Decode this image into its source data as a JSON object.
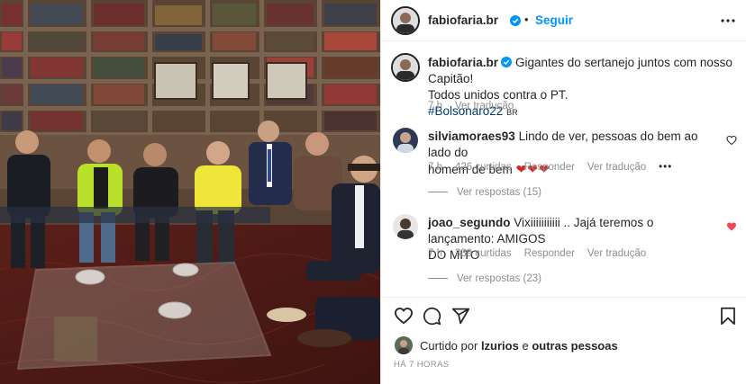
{
  "post": {
    "username": "fabiofaria.br",
    "follow_label": "Seguir",
    "caption_text": "Gigantes do sertanejo juntos com nosso Capitão! Todos unidos contra o PT.",
    "caption_line1": "Gigantes do sertanejo juntos com nosso Capitão!",
    "caption_line2": "Todos unidos contra o PT.",
    "hashtag": "#Bolsonaro22",
    "lang_badge": "BR",
    "time": "7 h",
    "translate_label": "Ver tradução"
  },
  "comments": [
    {
      "username": "silviamoraes93",
      "text": "Lindo de ver, pessoas do bem ao lado do homem de bem ❤️❤️❤️",
      "text_line1": "Lindo de ver, pessoas do bem ao lado do",
      "text_line2": "homem de bem",
      "emoji": "❤❤❤",
      "time": "7 h",
      "likes": "426 curtidas",
      "reply_label": "Responder",
      "translate_label": "Ver tradução",
      "more": "•••",
      "view_replies": "Ver respostas (15)",
      "liked": false
    },
    {
      "username": "joao_segundo",
      "text": "Vixiiiiiiiiiii .. Jajá teremos o lançamento: AMIGOS DO MITO",
      "text_line1": "Vixiiiiiiiiiii .. Jajá teremos o lançamento: AMIGOS",
      "text_line2": "DO MITO",
      "time": "7 h",
      "likes": "339 curtidas",
      "reply_label": "Responder",
      "translate_label": "Ver tradução",
      "view_replies": "Ver respostas (23)",
      "liked": true
    }
  ],
  "footer": {
    "liked_by_prefix": "Curtido por",
    "liked_by_user": "lzurios",
    "liked_by_and": "e",
    "liked_by_others": "outras pessoas",
    "time_ago": "HÁ 7 HORAS"
  },
  "icons": [
    "verified-icon",
    "more-icon",
    "heart-icon",
    "comment-icon",
    "share-icon",
    "save-icon"
  ],
  "colors": {
    "accent": "#0095f6",
    "verified": "#0095f6",
    "like_red": "#ed4956",
    "hashtag": "#00376b",
    "secondary": "#8e8e8e"
  }
}
